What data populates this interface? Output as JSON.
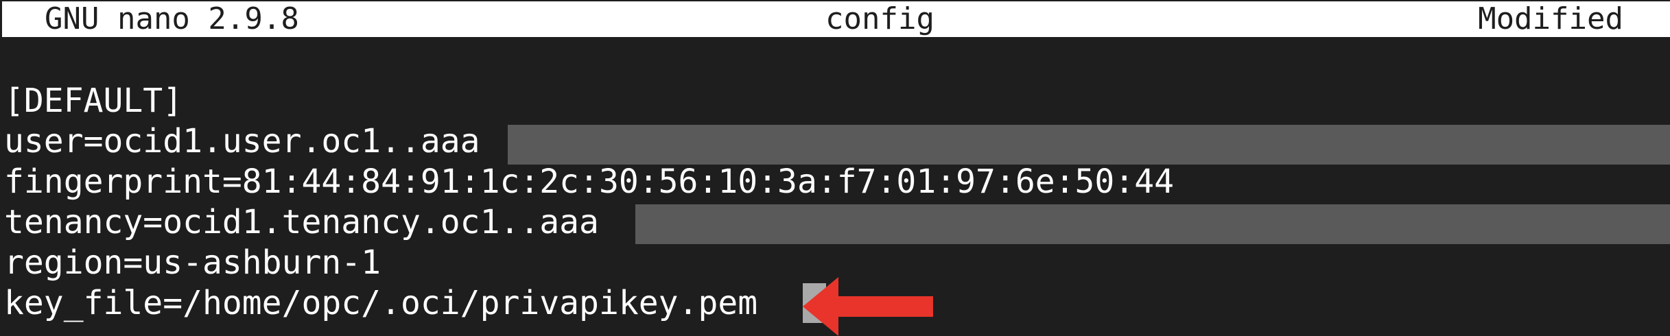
{
  "titlebar": {
    "app": "GNU nano 2.9.8",
    "filename": "config",
    "status": "Modified"
  },
  "buffer": {
    "lines": [
      "[DEFAULT]",
      "user=ocid1.user.oc1..aaa",
      "fingerprint=81:44:84:91:1c:2c:30:56:10:3a:f7:01:97:6e:50:44",
      "tenancy=ocid1.tenancy.oc1..aaa",
      "region=us-ashburn-1",
      "key_file=/home/opc/.oci/privapikey.pem"
    ]
  },
  "annotation": {
    "arrow_color": "#e8342a",
    "icon": "red-arrow-left-icon"
  },
  "colors": {
    "background": "#1e1e1e",
    "titlebar_bg": "#ffffff",
    "redaction": "#5a5a5a",
    "cursor": "#a9a9a9"
  }
}
